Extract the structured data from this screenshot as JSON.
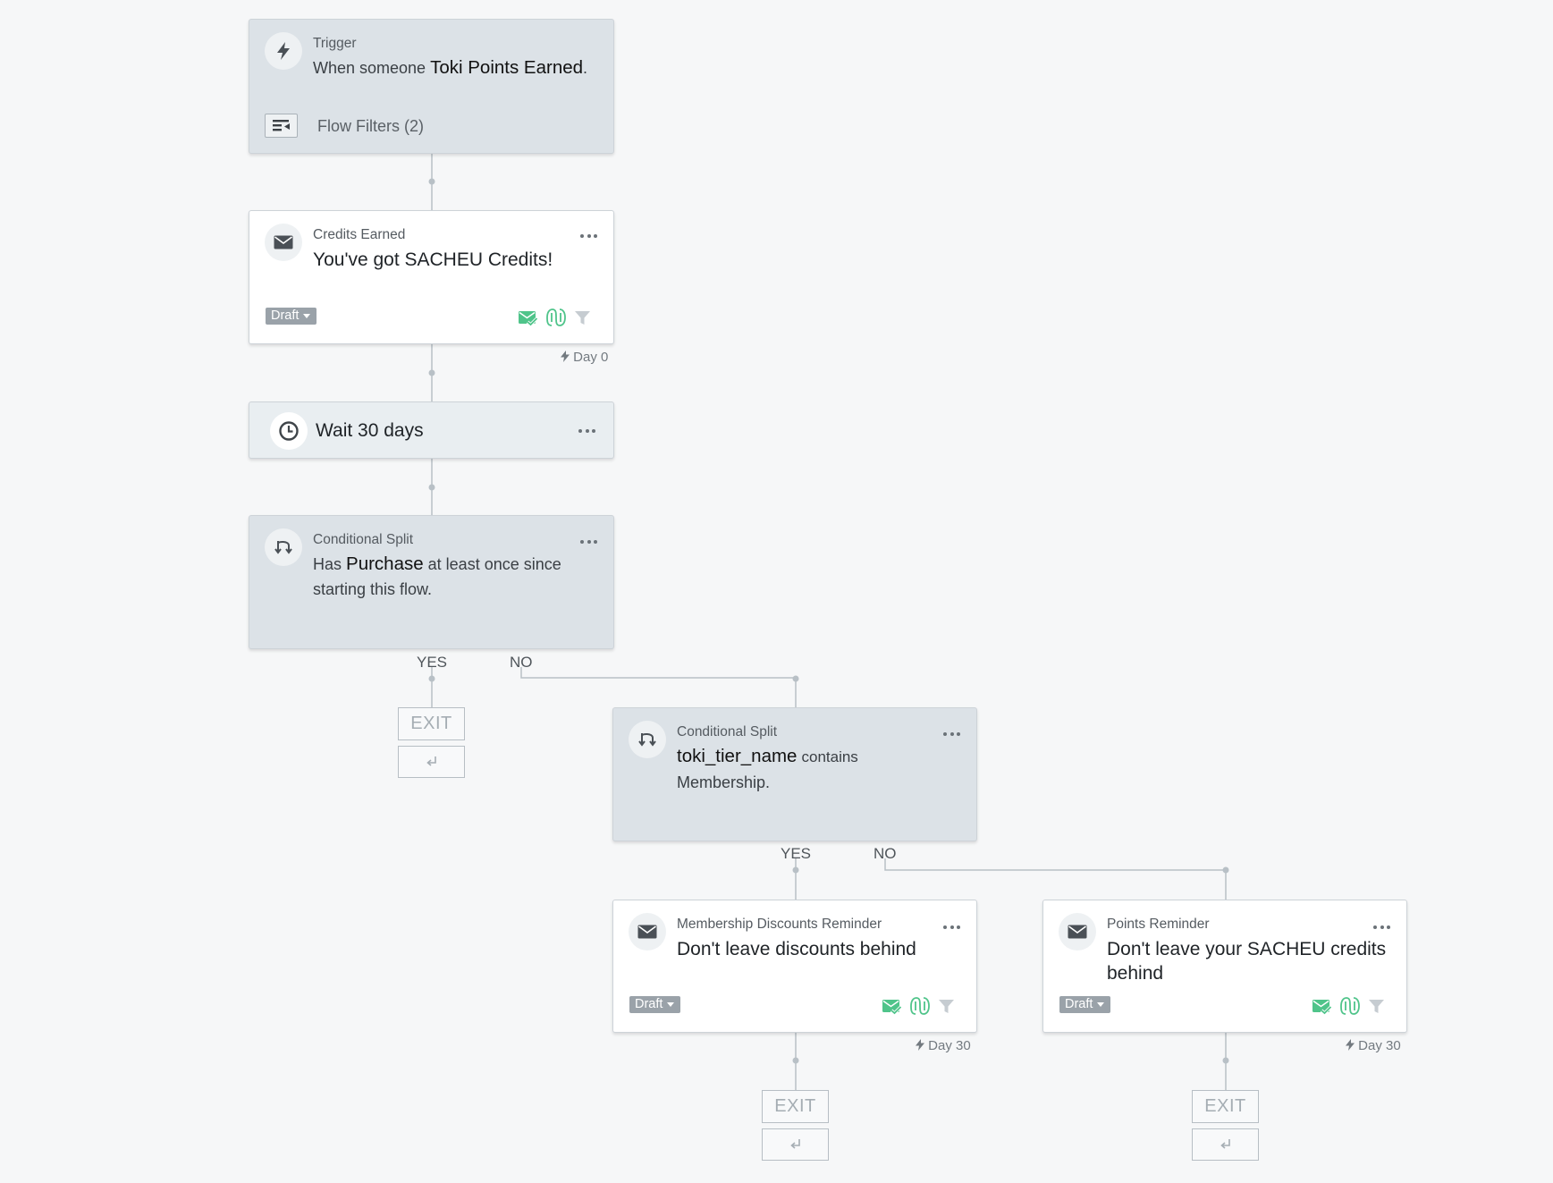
{
  "trigger": {
    "label": "Trigger",
    "prefix": "When someone",
    "metric": "Toki Points Earned",
    "suffix": ".",
    "filters_label": "Flow Filters (2)"
  },
  "email_credits": {
    "label": "Credits Earned",
    "title": "You've got SACHEU Credits!",
    "status": "Draft",
    "day": "Day 0"
  },
  "wait": {
    "title": "Wait 30 days"
  },
  "split_purchase": {
    "label": "Conditional Split",
    "pre": "Has",
    "metric": "Purchase",
    "post_line1": "at least once since",
    "post_line2": "starting this flow."
  },
  "branch_1": {
    "yes": "YES",
    "no": "NO",
    "exit": "EXIT"
  },
  "split_tier": {
    "label": "Conditional Split",
    "property": "toki_tier_name",
    "op": "contains",
    "value": "Membership."
  },
  "branch_2": {
    "yes": "YES",
    "no": "NO"
  },
  "email_membership": {
    "label": "Membership Discounts Reminder",
    "title": "Don't leave discounts behind",
    "status": "Draft",
    "day": "Day 30",
    "exit": "EXIT"
  },
  "email_points": {
    "label": "Points Reminder",
    "title_line1": "Don't leave your SACHEU credits",
    "title_line2": "behind",
    "status": "Draft",
    "day": "Day 30",
    "exit": "EXIT"
  },
  "colors": {
    "canvas": "#f6f7f8",
    "card_grey": "#dce2e7",
    "card_white": "#ffffff",
    "connector": "#b8c0c6",
    "status_green": "#4fc48a",
    "draft_badge": "#9aa2a9"
  }
}
